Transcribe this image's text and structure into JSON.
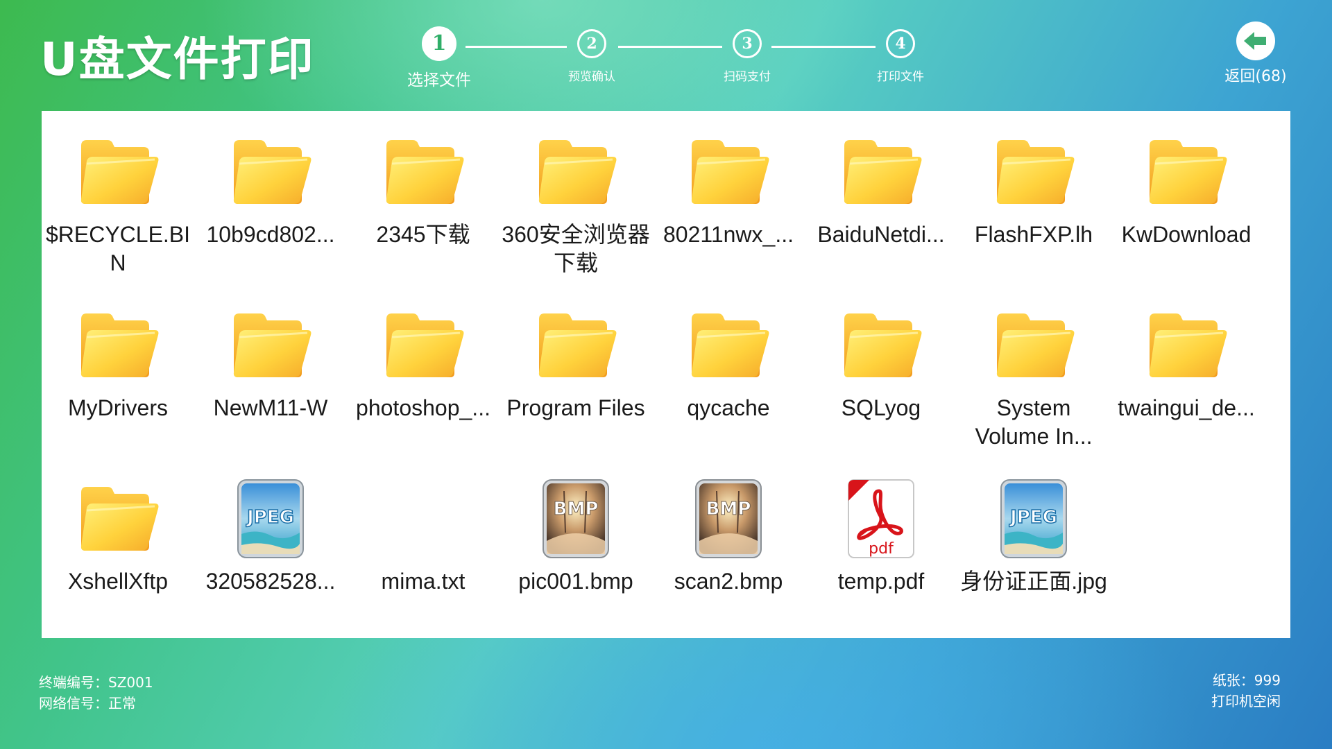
{
  "header": {
    "title": "U盘文件打印",
    "steps": [
      {
        "number": "1",
        "label": "选择文件",
        "active": true
      },
      {
        "number": "2",
        "label": "预览确认",
        "active": false
      },
      {
        "number": "3",
        "label": "扫码支付",
        "active": false
      },
      {
        "number": "4",
        "label": "打印文件",
        "active": false
      }
    ],
    "back": {
      "label": "返回(68)",
      "icon": "back-arrow-icon"
    }
  },
  "files": [
    {
      "name": "$RECYCLE.BIN",
      "type": "folder",
      "icon": "folder-icon"
    },
    {
      "name": "10b9cd802...",
      "type": "folder",
      "icon": "folder-icon"
    },
    {
      "name": "2345下载",
      "type": "folder",
      "icon": "folder-icon"
    },
    {
      "name": "360安全浏览器下载",
      "type": "folder",
      "icon": "folder-icon"
    },
    {
      "name": "80211nwx_...",
      "type": "folder",
      "icon": "folder-icon"
    },
    {
      "name": "BaiduNetdi...",
      "type": "folder",
      "icon": "folder-icon"
    },
    {
      "name": "FlashFXP.lh",
      "type": "folder",
      "icon": "folder-icon"
    },
    {
      "name": "KwDownload",
      "type": "folder",
      "icon": "folder-icon"
    },
    {
      "name": "MyDrivers",
      "type": "folder",
      "icon": "folder-icon"
    },
    {
      "name": "NewM11-W",
      "type": "folder",
      "icon": "folder-icon"
    },
    {
      "name": "photoshop_...",
      "type": "folder",
      "icon": "folder-icon"
    },
    {
      "name": "Program Files",
      "type": "folder",
      "icon": "folder-icon"
    },
    {
      "name": "qycache",
      "type": "folder",
      "icon": "folder-icon"
    },
    {
      "name": "SQLyog",
      "type": "folder",
      "icon": "folder-icon"
    },
    {
      "name": "System Volume In...",
      "type": "folder",
      "icon": "folder-icon"
    },
    {
      "name": "twaingui_de...",
      "type": "folder",
      "icon": "folder-icon"
    },
    {
      "name": "XshellXftp",
      "type": "folder",
      "icon": "folder-icon"
    },
    {
      "name": "320582528...",
      "type": "jpeg",
      "icon": "jpeg-file-icon",
      "badge": "JPEG"
    },
    {
      "name": "mima.txt",
      "type": "txt",
      "icon": "none"
    },
    {
      "name": "pic001.bmp",
      "type": "bmp",
      "icon": "bmp-file-icon",
      "badge": "BMP"
    },
    {
      "name": "scan2.bmp",
      "type": "bmp",
      "icon": "bmp-file-icon",
      "badge": "BMP"
    },
    {
      "name": "temp.pdf",
      "type": "pdf",
      "icon": "pdf-file-icon",
      "badge": "pdf"
    },
    {
      "name": "身份证正面.jpg",
      "type": "jpeg",
      "icon": "jpeg-file-icon",
      "badge": "JPEG"
    }
  ],
  "footer": {
    "terminal": "终端编号：SZ001",
    "network": "网络信号：正常",
    "paper": "纸张：999",
    "printer_status": "打印机空闲"
  },
  "colors": {
    "accent": "#2fae68",
    "panel": "#ffffff",
    "folder": "#ffc93a"
  }
}
